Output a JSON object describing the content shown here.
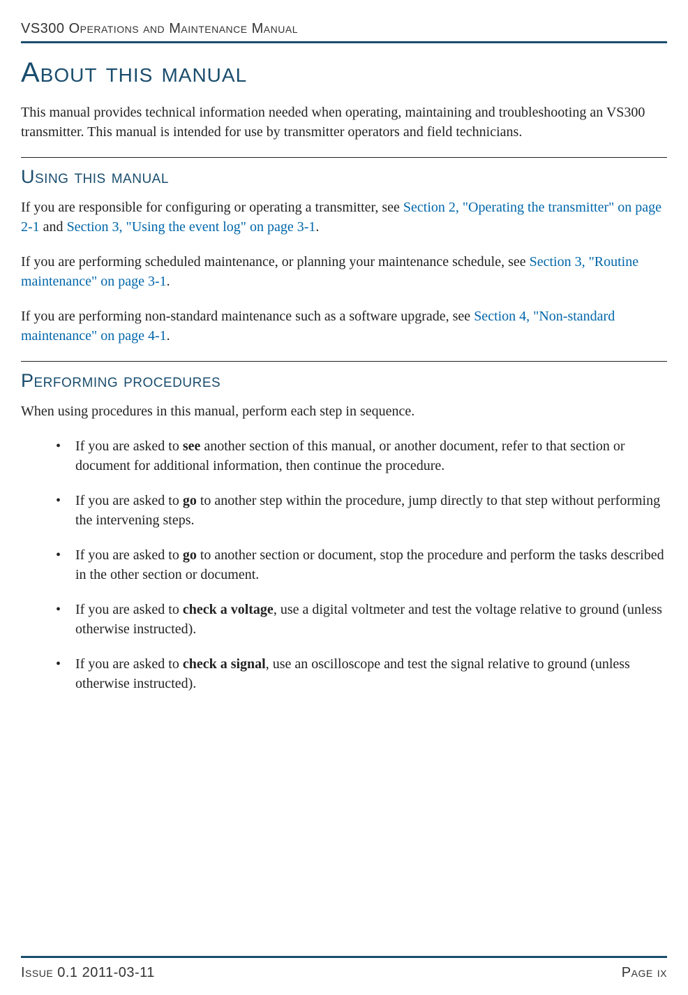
{
  "header": {
    "title": "VS300 Operations and Maintenance Manual"
  },
  "main_title": "About this manual",
  "intro_para": "This manual provides technical information needed when operating, maintaining and troubleshooting an VS300 transmitter. This manual is intended for use by transmitter operators and field technicians.",
  "sections": {
    "using": {
      "title": "Using this manual",
      "para1_pre": "If you are responsible for configuring or operating a transmitter, see ",
      "para1_link1": "Section 2, \"Operating the transmitter\" on page 2-1",
      "para1_mid": " and ",
      "para1_link2": "Section 3, \"Using the event log\" on page 3-1",
      "para1_post": ".",
      "para2_pre": "If you are performing scheduled maintenance, or planning your maintenance schedule, see ",
      "para2_link": "Section 3, \"Routine maintenance\" on page 3-1",
      "para2_post": ".",
      "para3_pre": "If you are performing non-standard maintenance such as a software upgrade, see ",
      "para3_link": "Section 4, \"Non-standard maintenance\" on page 4-1",
      "para3_post": "."
    },
    "performing": {
      "title": "Performing procedures",
      "intro": "When using procedures in this manual, perform each step in sequence.",
      "bullets": [
        {
          "pre": "If you are asked to ",
          "bold": "see",
          "post": " another section of this manual, or another document, refer to that section or document for additional information, then continue the procedure."
        },
        {
          "pre": "If you are asked to ",
          "bold": "go",
          "post": " to another step within the procedure, jump directly to that step without performing the intervening steps."
        },
        {
          "pre": "If you are asked to ",
          "bold": "go",
          "post": " to another section or document, stop the procedure and perform the tasks described in the other section or document."
        },
        {
          "pre": "If you are asked to ",
          "bold": "check a voltage",
          "post": ", use a digital voltmeter and test the voltage relative to ground (unless otherwise instructed)."
        },
        {
          "pre": "If you are asked to ",
          "bold": "check a signal",
          "post": ", use an oscilloscope and test the signal relative to ground (unless otherwise instructed)."
        }
      ]
    }
  },
  "footer": {
    "left": "Issue 0.1  2011-03-11",
    "right": "Page ix"
  }
}
